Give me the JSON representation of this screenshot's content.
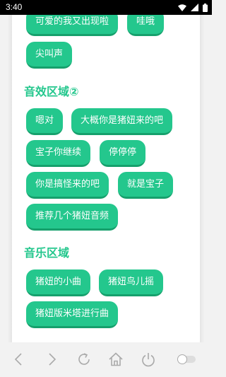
{
  "status": {
    "time": "3:40"
  },
  "sections": {
    "top": {
      "buttons": [
        "可爱的我又出现啦",
        "哇哦",
        "尖叫声"
      ]
    },
    "sfx": {
      "title": "音效区域②",
      "buttons": [
        "嗯对",
        "大概你是猪妞来的吧",
        "宝子你继续",
        "停停停",
        "你是搞怪来的吧",
        "就是宝子",
        "推荐几个猪妞音频"
      ]
    },
    "music": {
      "title": "音乐区域",
      "buttons": [
        "猪妞的小曲",
        "猪妞鸟儿摇",
        "猪妞版米塔进行曲"
      ]
    }
  },
  "nav": {
    "icons": [
      "back-icon",
      "forward-icon",
      "refresh-icon",
      "home-icon",
      "power-icon",
      "toggle-switch"
    ]
  },
  "colors": {
    "accent": "#24c78d",
    "accent_dark": "#16a06c",
    "nav_icon": "#aaaaaa"
  }
}
